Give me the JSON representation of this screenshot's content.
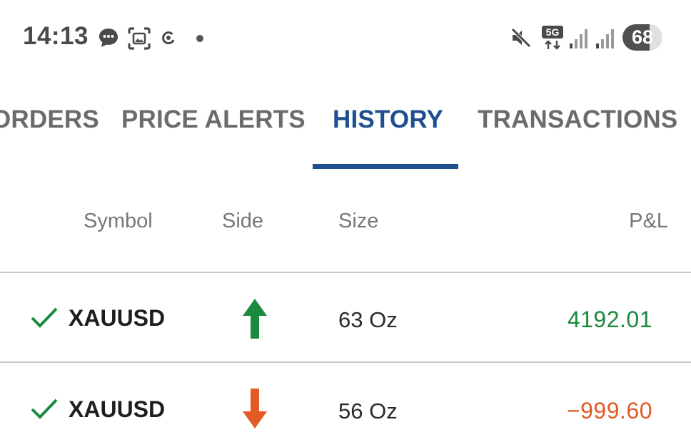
{
  "status_bar": {
    "time": "14:13",
    "network_label": "5G",
    "battery_percent": 68,
    "battery_label": "68",
    "icons": [
      "chat-icon",
      "screenshot-icon",
      "swirl-icon",
      "dot-icon",
      "mute-icon",
      "network-5g-icon",
      "signal-icon",
      "signal-icon"
    ]
  },
  "tabs": [
    {
      "label": "ORDERS",
      "active": false
    },
    {
      "label": "PRICE ALERTS",
      "active": false
    },
    {
      "label": "HISTORY",
      "active": true
    },
    {
      "label": "TRANSACTIONS",
      "active": false
    }
  ],
  "table": {
    "headers": {
      "symbol": "Symbol",
      "side": "Side",
      "size": "Size",
      "pl": "P&L"
    },
    "rows": [
      {
        "symbol": "XAUUSD",
        "side": "buy",
        "side_icon": "arrow-up-icon",
        "size": "63 Oz",
        "pl": "4192.01",
        "pl_color": "#1a8a3e"
      },
      {
        "symbol": "XAUUSD",
        "side": "sell",
        "side_icon": "arrow-down-icon",
        "size": "56 Oz",
        "pl": "−999.60",
        "pl_color": "#e35a24"
      }
    ]
  },
  "colors": {
    "accent": "#1e4f8f",
    "positive": "#1a8a3e",
    "negative": "#e35a24",
    "check": "#1a8a3e",
    "tab_inactive": "#6b6b6b"
  }
}
